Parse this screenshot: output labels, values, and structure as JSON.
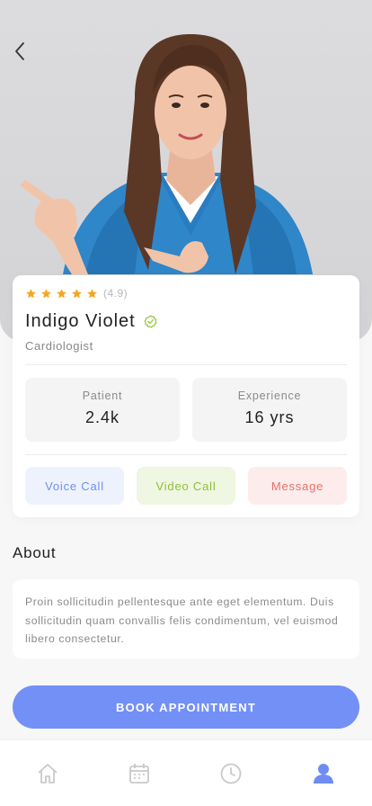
{
  "colors": {
    "accent": "#7390f6",
    "star": "#f5a623",
    "verified": "#8cc236",
    "voice_text": "#6f8ef0",
    "video_text": "#8cc236",
    "message_text": "#e9706a"
  },
  "header": {
    "back_icon": "chevron-left-icon"
  },
  "doctor": {
    "rating_stars": 5,
    "rating_text": "(4.9)",
    "name": "Indigo Violet",
    "specialty": "Cardiologist"
  },
  "stats": {
    "patient_label": "Patient",
    "patient_value": "2.4k",
    "experience_label": "Experience",
    "experience_value": "16 yrs"
  },
  "actions": {
    "voice": "Voice Call",
    "video": "Video Call",
    "message": "Message"
  },
  "about": {
    "title": "About",
    "text": "Proin sollicitudin pellentesque ante eget elementum. Duis sollicitudin quam convallis felis condimentum, vel euismod libero consectetur."
  },
  "book_label": "BOOK APPOINTMENT",
  "nav": [
    {
      "icon": "home-icon",
      "active": false
    },
    {
      "icon": "calendar-icon",
      "active": false
    },
    {
      "icon": "clock-icon",
      "active": false
    },
    {
      "icon": "profile-icon",
      "active": true
    }
  ]
}
